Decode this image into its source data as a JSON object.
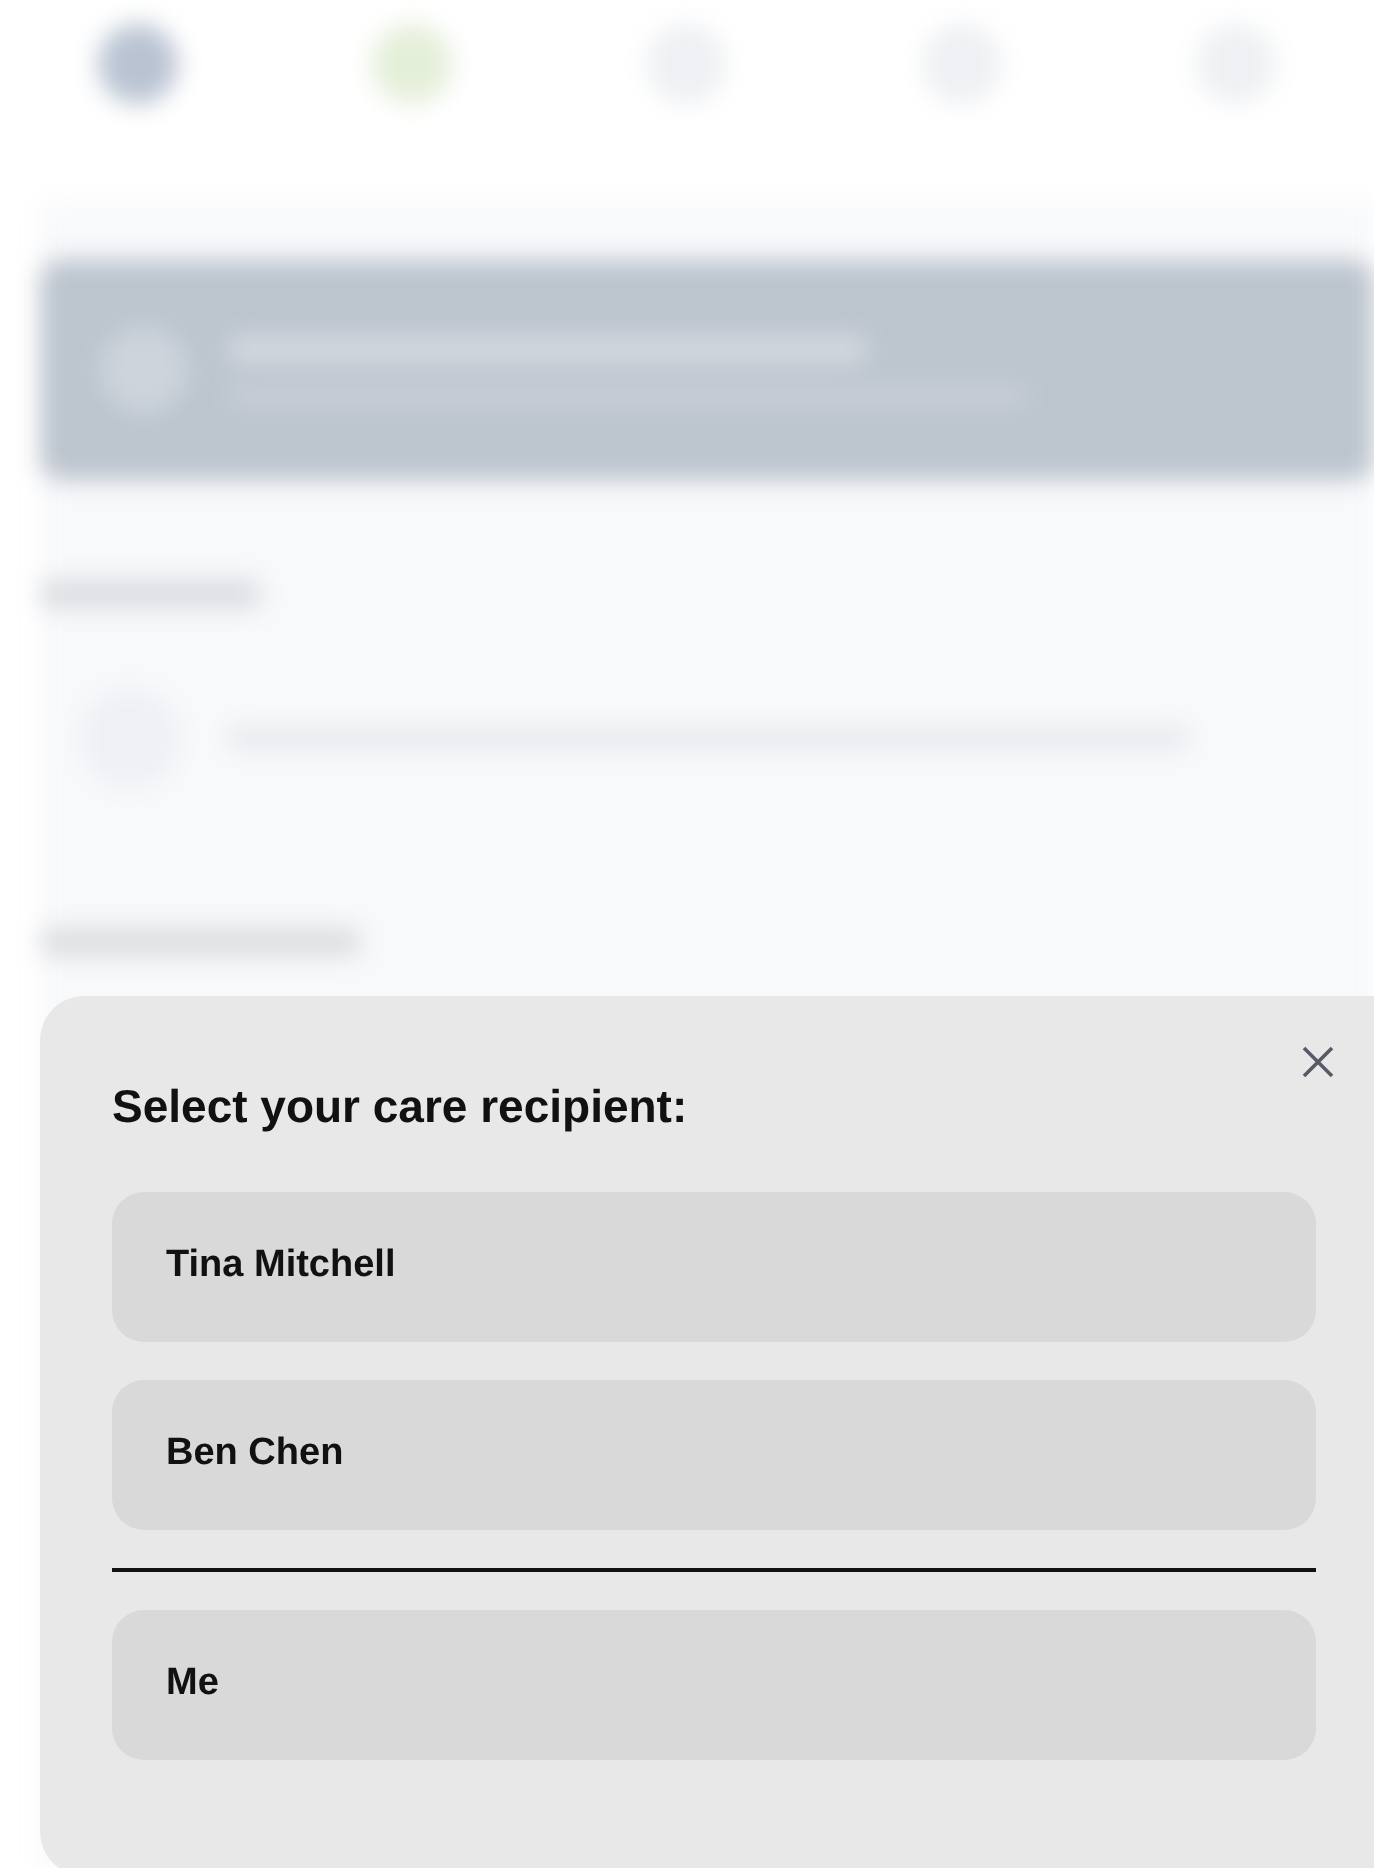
{
  "sheet": {
    "title": "Select your care recipient:",
    "recipients": [
      {
        "label": "Tina Mitchell"
      },
      {
        "label": "Ben Chen"
      }
    ],
    "self_options": [
      {
        "label": "Me"
      }
    ]
  }
}
